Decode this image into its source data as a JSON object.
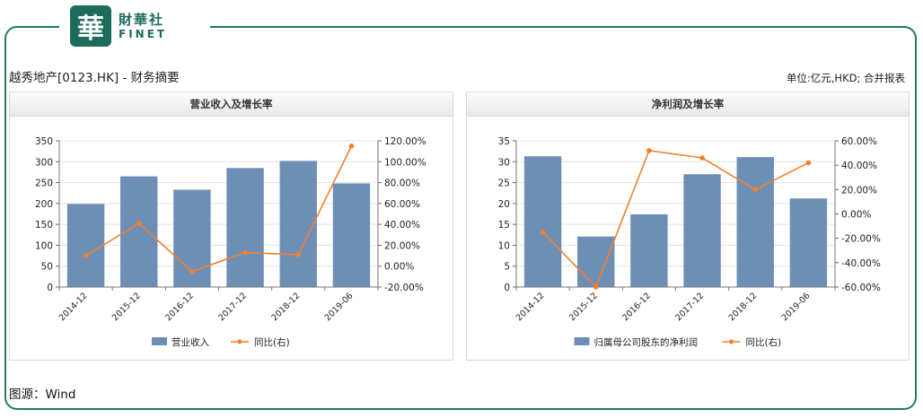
{
  "logo": {
    "mark": "華",
    "cn": "財華社",
    "en": "FINET"
  },
  "page": {
    "title": "越秀地产[0123.HK] - 财务摘要",
    "unit": "单位:亿元,HKD; 合并报表"
  },
  "source": "图源：Wind",
  "colors": {
    "bar": "#6e8fb5",
    "line": "#f07f2e",
    "frame": "#1f7a6a"
  },
  "chart_data": [
    {
      "type": "bar",
      "title": "营业收入及增长率",
      "categories": [
        "2014-12",
        "2015-12",
        "2016-12",
        "2017-12",
        "2018-12",
        "2019-06"
      ],
      "series": [
        {
          "name": "营业收入",
          "type": "bar",
          "axis": "left",
          "values": [
            199,
            265,
            233,
            285,
            302,
            248
          ]
        },
        {
          "name": "同比(右)",
          "type": "line",
          "axis": "right",
          "values": [
            10,
            41,
            -5,
            13,
            11,
            115
          ]
        }
      ],
      "y_left": {
        "min": 0,
        "max": 350,
        "step": 50,
        "ticks": [
          "0",
          "50",
          "100",
          "150",
          "200",
          "250",
          "300",
          "350"
        ]
      },
      "y_right": {
        "min": -20,
        "max": 120,
        "step": 20,
        "ticks": [
          "-20.00%",
          "0.00%",
          "20.00%",
          "40.00%",
          "60.00%",
          "80.00%",
          "100.00%",
          "120.00%"
        ]
      },
      "grid": true,
      "legend": "bottom"
    },
    {
      "type": "bar",
      "title": "净利润及增长率",
      "categories": [
        "2014-12",
        "2015-12",
        "2016-12",
        "2017-12",
        "2018-12",
        "2019-06"
      ],
      "series": [
        {
          "name": "归属母公司股东的净利润",
          "type": "bar",
          "axis": "left",
          "values": [
            31.3,
            12.1,
            17.4,
            27.0,
            31.1,
            21.2
          ]
        },
        {
          "name": "同比(右)",
          "type": "line",
          "axis": "right",
          "values": [
            -15,
            -60,
            52,
            46,
            20,
            42
          ]
        }
      ],
      "y_left": {
        "min": 0,
        "max": 35,
        "step": 5,
        "ticks": [
          "0",
          "5",
          "10",
          "15",
          "20",
          "25",
          "30",
          "35"
        ]
      },
      "y_right": {
        "min": -60,
        "max": 60,
        "step": 20,
        "ticks": [
          "-60.00%",
          "-40.00%",
          "-20.00%",
          "0.00%",
          "20.00%",
          "40.00%",
          "60.00%"
        ]
      },
      "grid": true,
      "legend": "bottom"
    }
  ]
}
